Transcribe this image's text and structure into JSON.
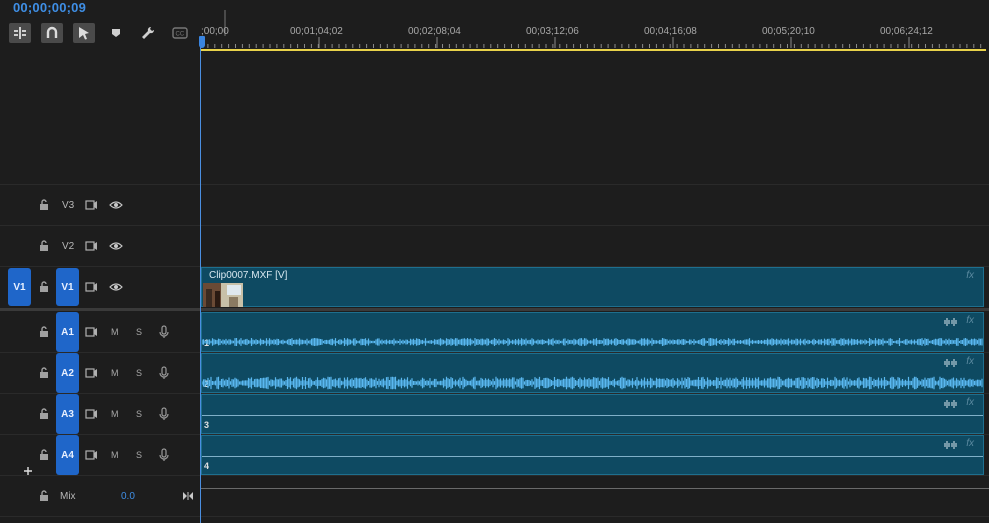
{
  "timecode": "00;00;00;09",
  "toolbar": [
    "insert-snap-icon",
    "magnet-icon",
    "linked-selection-icon",
    "marker-icon",
    "wrench-icon",
    "captions-icon"
  ],
  "ruler": {
    "labels": [
      ";00;00",
      "00;01;04;02",
      "00;02;08;04",
      "00;03;12;06",
      "00;04;16;08",
      "00;05;20;10",
      "00;06;24;12"
    ]
  },
  "video_tracks": [
    {
      "name": "V3",
      "source": ""
    },
    {
      "name": "V2",
      "source": ""
    },
    {
      "name": "V1",
      "source": "V1"
    }
  ],
  "audio_tracks": [
    {
      "name": "A1",
      "mute": "M",
      "solo": "S",
      "clip_num": "1",
      "has_wave": true
    },
    {
      "name": "A2",
      "mute": "M",
      "solo": "S",
      "clip_num": "2",
      "has_wave": true
    },
    {
      "name": "A3",
      "mute": "M",
      "solo": "S",
      "clip_num": "3",
      "has_wave": false
    },
    {
      "name": "A4",
      "mute": "M",
      "solo": "S",
      "clip_num": "4",
      "has_wave": false
    }
  ],
  "mix": {
    "label": "Mix",
    "value": "0.0"
  },
  "video_clip": {
    "name": "Clip0007.MXF [V]",
    "fx": "fx"
  },
  "audio_fx": "fx",
  "colors": {
    "accent": "#1f66c9",
    "clip": "#0e4a62",
    "wave": "#5ab8f0",
    "yellow": "#e8d24a"
  }
}
